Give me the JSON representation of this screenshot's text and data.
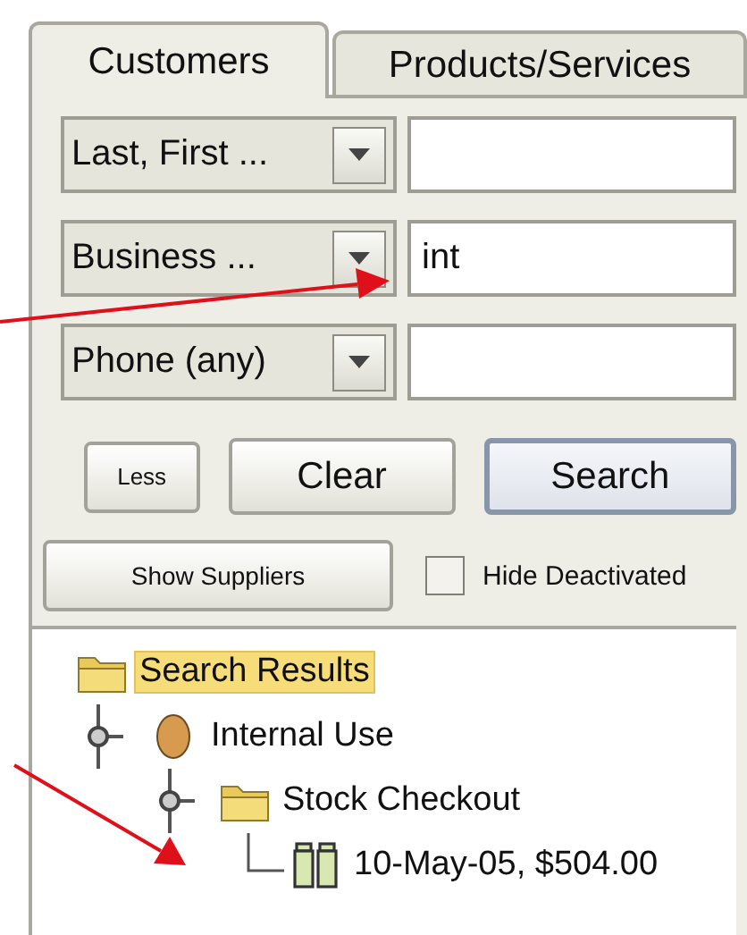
{
  "tabs": [
    {
      "label": "Customers",
      "selected": true
    },
    {
      "label": "Products/Services",
      "selected": false
    }
  ],
  "search_rows": [
    {
      "field": "Last, First ..."
    },
    {
      "field": "Business ...",
      "value": "int"
    },
    {
      "field": "Phone (any)"
    }
  ],
  "buttons": [
    {
      "label": "Less",
      "default": false
    },
    {
      "label": "Clear",
      "default": false
    },
    {
      "label": "Search",
      "default": true
    }
  ],
  "show_suppliers_button": "Show Suppliers",
  "hide_deactivated": {
    "label": "Hide Deactivated",
    "checked": false
  },
  "tree": [
    {
      "label": "Search Results",
      "kind": "folder",
      "selected": true,
      "children": [
        {
          "label": "Internal Use",
          "kind": "customer",
          "selected": false,
          "expanded": true,
          "children": [
            {
              "label": "Stock Checkout",
              "kind": "folder",
              "selected": false,
              "expanded": true,
              "children": [
                {
                  "label": "10-May-05, $504.00",
                  "kind": "transaction",
                  "selected": false
                }
              ]
            }
          ]
        }
      ]
    }
  ]
}
